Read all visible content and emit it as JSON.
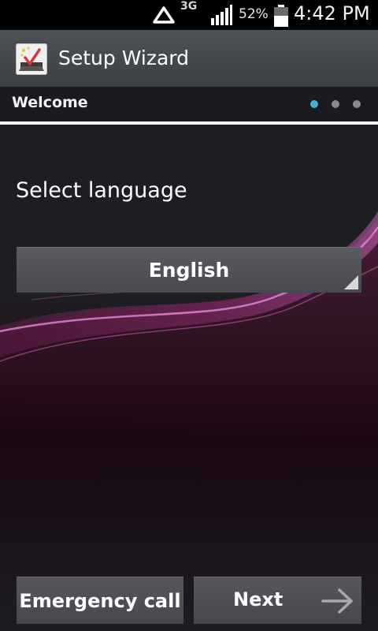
{
  "status_bar": {
    "network_icon": "triangle-network-icon",
    "network_type": "3G",
    "signal_icon": "signal-bars-icon",
    "battery_percent": "52%",
    "battery_icon": "battery-icon",
    "time": "4:42 PM"
  },
  "title_bar": {
    "app_icon": "setup-wizard-app-icon",
    "title": "Setup Wizard"
  },
  "step": {
    "title": "Welcome",
    "page_indicator": {
      "total": 3,
      "current": 1
    },
    "accent_color": "#3fb2d8"
  },
  "main": {
    "prompt": "Select language",
    "language_select": {
      "value": "English"
    }
  },
  "footer": {
    "emergency_label": "Emergency call",
    "next_label": "Next",
    "next_icon": "arrow-right-icon"
  }
}
